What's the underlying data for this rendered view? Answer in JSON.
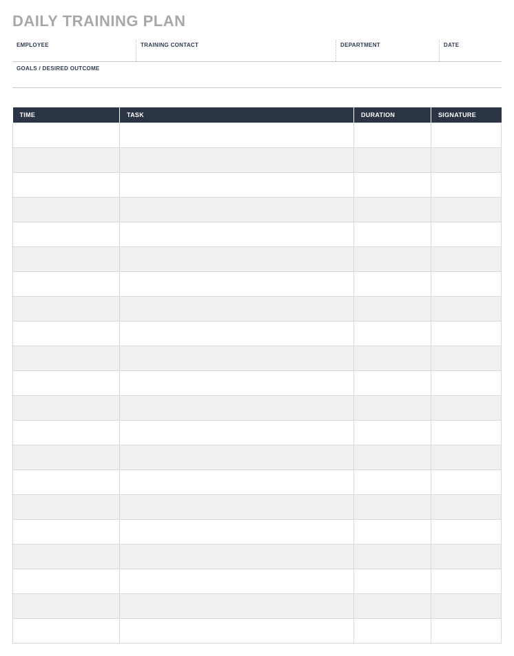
{
  "title": "DAILY TRAINING PLAN",
  "info": {
    "employee_label": "EMPLOYEE",
    "employee_value": "",
    "contact_label": "TRAINING CONTACT",
    "contact_value": "",
    "department_label": "DEPARTMENT",
    "department_value": "",
    "date_label": "DATE",
    "date_value": "",
    "goals_label": "GOALS / DESIRED OUTCOME",
    "goals_value": ""
  },
  "schedule": {
    "headers": {
      "time": "TIME",
      "task": "TASK",
      "duration": "DURATION",
      "signature": "SIGNATURE"
    },
    "rows": [
      {
        "time": "",
        "task": "",
        "duration": "",
        "signature": ""
      },
      {
        "time": "",
        "task": "",
        "duration": "",
        "signature": ""
      },
      {
        "time": "",
        "task": "",
        "duration": "",
        "signature": ""
      },
      {
        "time": "",
        "task": "",
        "duration": "",
        "signature": ""
      },
      {
        "time": "",
        "task": "",
        "duration": "",
        "signature": ""
      },
      {
        "time": "",
        "task": "",
        "duration": "",
        "signature": ""
      },
      {
        "time": "",
        "task": "",
        "duration": "",
        "signature": ""
      },
      {
        "time": "",
        "task": "",
        "duration": "",
        "signature": ""
      },
      {
        "time": "",
        "task": "",
        "duration": "",
        "signature": ""
      },
      {
        "time": "",
        "task": "",
        "duration": "",
        "signature": ""
      },
      {
        "time": "",
        "task": "",
        "duration": "",
        "signature": ""
      },
      {
        "time": "",
        "task": "",
        "duration": "",
        "signature": ""
      },
      {
        "time": "",
        "task": "",
        "duration": "",
        "signature": ""
      },
      {
        "time": "",
        "task": "",
        "duration": "",
        "signature": ""
      },
      {
        "time": "",
        "task": "",
        "duration": "",
        "signature": ""
      },
      {
        "time": "",
        "task": "",
        "duration": "",
        "signature": ""
      },
      {
        "time": "",
        "task": "",
        "duration": "",
        "signature": ""
      },
      {
        "time": "",
        "task": "",
        "duration": "",
        "signature": ""
      },
      {
        "time": "",
        "task": "",
        "duration": "",
        "signature": ""
      },
      {
        "time": "",
        "task": "",
        "duration": "",
        "signature": ""
      },
      {
        "time": "",
        "task": "",
        "duration": "",
        "signature": ""
      }
    ]
  }
}
